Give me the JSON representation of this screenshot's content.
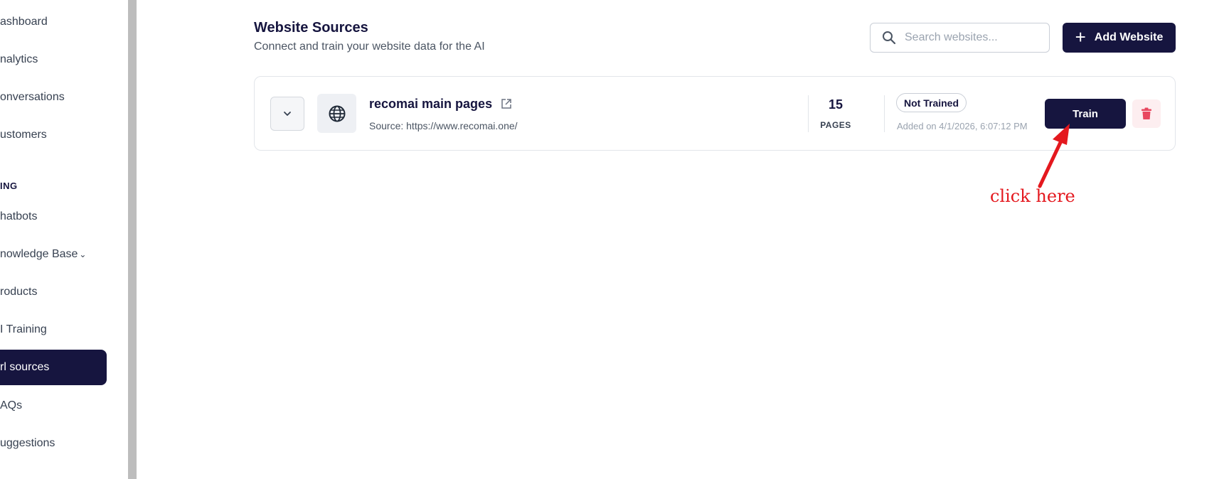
{
  "sidebar": {
    "items": [
      {
        "label": "ashboard",
        "active": false
      },
      {
        "label": "nalytics",
        "active": false
      },
      {
        "label": "onversations",
        "active": false
      },
      {
        "label": "ustomers",
        "active": false
      },
      {
        "label": "hatbots",
        "active": false
      },
      {
        "label": "nowledge Base",
        "active": false
      },
      {
        "label": "roducts",
        "active": false
      },
      {
        "label": "I Training",
        "active": false
      },
      {
        "label": "rl sources",
        "active": true
      },
      {
        "label": "AQs",
        "active": false
      },
      {
        "label": "uggestions",
        "active": false
      }
    ],
    "section_label": "ING"
  },
  "header": {
    "title": "Website Sources",
    "subtitle": "Connect and train your website data for the AI",
    "search_placeholder": "Search websites...",
    "add_label": "Add Website"
  },
  "source": {
    "name": "recomai main pages",
    "url": "Source: https://www.recomai.one/",
    "pages_count": "15",
    "pages_label": "PAGES",
    "status": "Not Trained",
    "added_on": "Added on 4/1/2026, 6:07:12 PM",
    "train_label": "Train"
  },
  "annotation": {
    "text": "click here",
    "color": "#e4181e"
  },
  "colors": {
    "primary": "#16153f",
    "danger": "#e8475f",
    "danger_bg": "#fdeef0"
  },
  "icons": [
    "search-icon",
    "plus-icon",
    "chevron-down-icon",
    "globe-icon",
    "external-link-icon",
    "trash-icon"
  ]
}
